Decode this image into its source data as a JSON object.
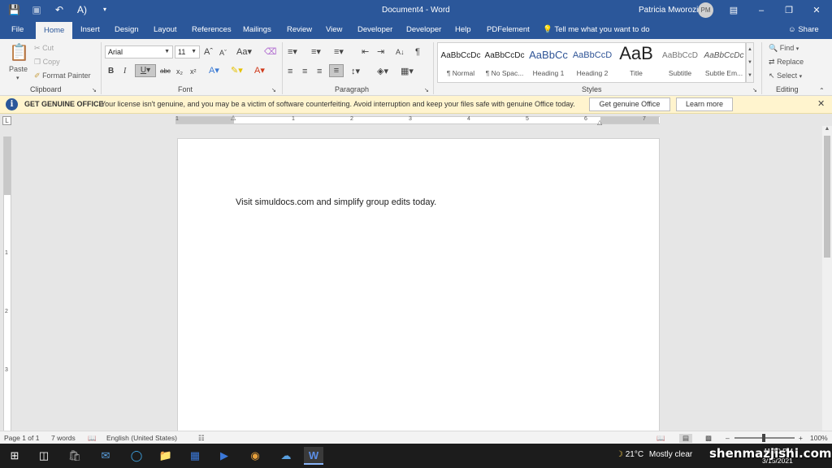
{
  "titlebar": {
    "doc_title": "Document4  -  Word",
    "user_name": "Patricia Mworozi",
    "user_initials": "PM",
    "accent": "#2b579a"
  },
  "tabs": [
    "File",
    "Home",
    "Insert",
    "Design",
    "Layout",
    "References",
    "Mailings",
    "Review",
    "View",
    "Developer",
    "Developer",
    "Help",
    "PDFelement"
  ],
  "active_tab": "Home",
  "tell_me": "Tell me what you want to do",
  "share_label": "Share",
  "clipboard": {
    "paste": "Paste",
    "cut": "Cut",
    "copy": "Copy",
    "format_painter": "Format Painter",
    "group_label": "Clipboard"
  },
  "font": {
    "family": "Arial",
    "size": "11",
    "group_label": "Font"
  },
  "paragraph": {
    "group_label": "Paragraph"
  },
  "styles": {
    "group_label": "Styles",
    "items": [
      {
        "sample": "AaBbCcDc",
        "name": "¶ Normal"
      },
      {
        "sample": "AaBbCcDc",
        "name": "¶ No Spac..."
      },
      {
        "sample": "AaBbCc",
        "name": "Heading 1"
      },
      {
        "sample": "AaBbCcD",
        "name": "Heading 2"
      },
      {
        "sample": "AaB",
        "name": "Title"
      },
      {
        "sample": "AaBbCcD",
        "name": "Subtitle"
      },
      {
        "sample": "AaBbCcDc",
        "name": "Subtle Em..."
      }
    ]
  },
  "editing": {
    "find": "Find",
    "replace": "Replace",
    "select": "Select",
    "group_label": "Editing"
  },
  "warning": {
    "heading": "GET GENUINE OFFICE",
    "message": "Your license isn't genuine, and you may be a victim of software counterfeiting. Avoid interruption and keep your files safe with genuine Office today.",
    "primary_button": "Get genuine Office",
    "secondary_button": "Learn more"
  },
  "ruler": {
    "numbers": [
      "1",
      "1",
      "2",
      "3",
      "4",
      "5",
      "6",
      "7"
    ],
    "vertical_numbers": [
      "1",
      "2",
      "3"
    ]
  },
  "document": {
    "text": "Visit simuldocs.com and simplify group edits today."
  },
  "status": {
    "page": "Page 1 of 1",
    "words": "7 words",
    "language": "English (United States)",
    "zoom": "100%"
  },
  "taskbar": {
    "temperature": "21°C",
    "weather": "Mostly clear",
    "time": "11:10 PM",
    "date": "3/15/2021"
  },
  "watermark": "shenmazjishi.com"
}
